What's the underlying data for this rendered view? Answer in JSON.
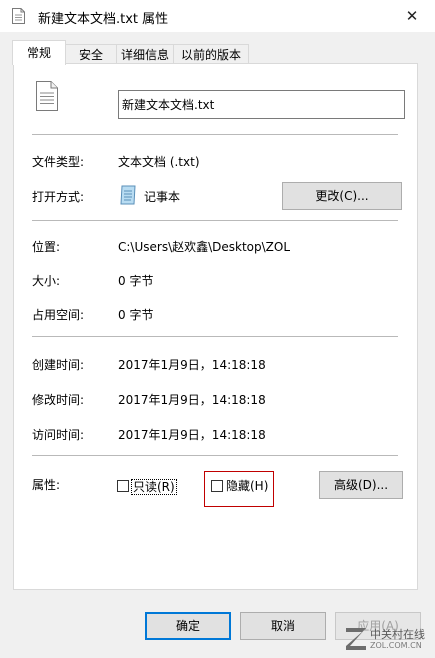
{
  "window": {
    "title": "新建文本文档.txt 属性",
    "close_glyph": "✕"
  },
  "tabs": [
    {
      "label": "常规",
      "active": true
    },
    {
      "label": "安全",
      "active": false
    },
    {
      "label": "详细信息",
      "active": false
    },
    {
      "label": "以前的版本",
      "active": false
    }
  ],
  "general": {
    "filename": "新建文本文档.txt",
    "type_label": "文件类型:",
    "type_value": "文本文档 (.txt)",
    "opens_with_label": "打开方式:",
    "opens_with_value": "记事本",
    "change_button": "更改(C)...",
    "location_label": "位置:",
    "location_value": "C:\\Users\\赵欢鑫\\Desktop\\ZOL",
    "size_label": "大小:",
    "size_value": "0 字节",
    "size_on_disk_label": "占用空间:",
    "size_on_disk_value": "0 字节",
    "created_label": "创建时间:",
    "created_value": "2017年1月9日，14:18:18",
    "modified_label": "修改时间:",
    "modified_value": "2017年1月9日，14:18:18",
    "accessed_label": "访问时间:",
    "accessed_value": "2017年1月9日，14:18:18",
    "attributes_label": "属性:",
    "readonly_label": "只读(R)",
    "readonly_checked": false,
    "hidden_label": "隐藏(H)",
    "hidden_checked": false,
    "advanced_button": "高级(D)..."
  },
  "footer": {
    "ok": "确定",
    "cancel": "取消",
    "apply": "应用(A)"
  },
  "watermark": {
    "text_cn": "中关村在线",
    "text_en": "ZOL.COM.CN"
  },
  "colors": {
    "highlight_box": "#c00000",
    "primary_border": "#0078d7"
  }
}
